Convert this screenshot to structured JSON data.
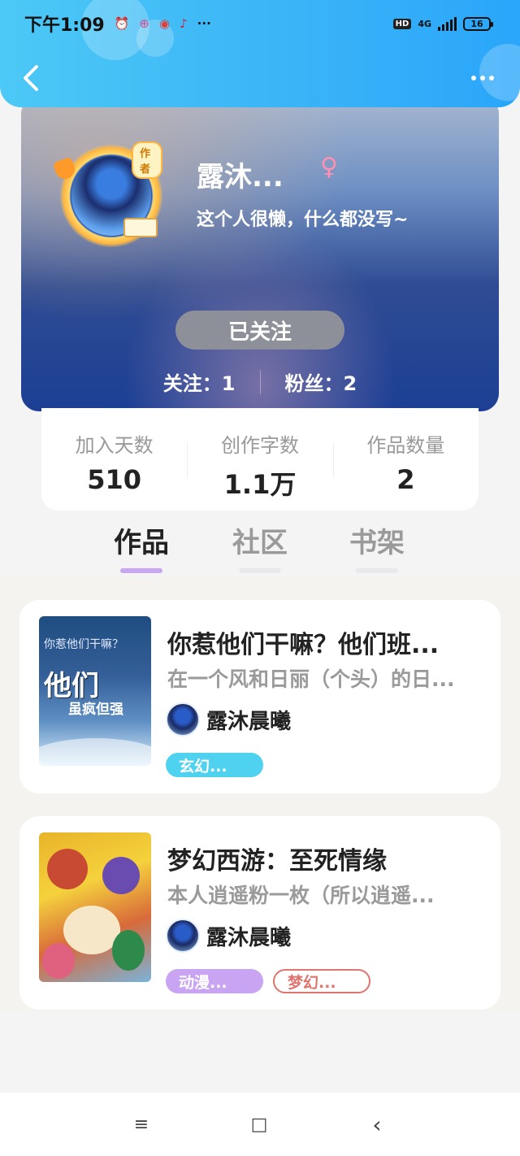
{
  "status_bar": {
    "time": "下午1:09",
    "notif_icons": [
      "alarm-icon",
      "app-icon-pink",
      "app-icon-red",
      "app-icon-tiktok"
    ],
    "more_notifs": "···",
    "hd": "HD",
    "network": "4G",
    "battery": "16"
  },
  "header": {
    "back_icon": "chevron-left-icon",
    "more_icon": "more-dots-icon"
  },
  "profile": {
    "author_badge": "作者",
    "name": "露沐...",
    "gender_symbol": "♀",
    "bio": "这个人很懒，什么都没写~",
    "follow_label": "已关注",
    "following": "关注：1",
    "fans": "粉丝：2"
  },
  "info": [
    {
      "label": "加入天数",
      "value": "510"
    },
    {
      "label": "创作字数",
      "value": "1.1万"
    },
    {
      "label": "作品数量",
      "value": "2"
    }
  ],
  "tabs": [
    "作品",
    "社区",
    "书架"
  ],
  "active_tab": 0,
  "works": [
    {
      "title": "你惹他们干嘛？他们班...",
      "desc": "在一个风和日丽（个头）的日...",
      "author": "露沐晨曦",
      "cover_top": "你惹他们干嘛？",
      "cover_title": "他们",
      "cover_sub": "虽疯但强",
      "tags": [
        {
          "label": "玄幻...",
          "color": "#4fd2f0",
          "style": "filled"
        }
      ]
    },
    {
      "title": "梦幻西游：至死情缘",
      "desc": "本人逍遥粉一枚（所以逍遥...",
      "author": "露沐晨曦",
      "tags": [
        {
          "label": "动漫...",
          "color": "#c8a4f2",
          "style": "filled"
        },
        {
          "label": "梦幻...",
          "color": "#e0746e",
          "style": "outline"
        }
      ]
    }
  ],
  "nav": {
    "menu": "≡",
    "home": "□",
    "back": "‹"
  },
  "colors": {
    "header": "#3bb4f7",
    "accent": "#c9a6f3",
    "follow_btn": "#8e9099"
  }
}
